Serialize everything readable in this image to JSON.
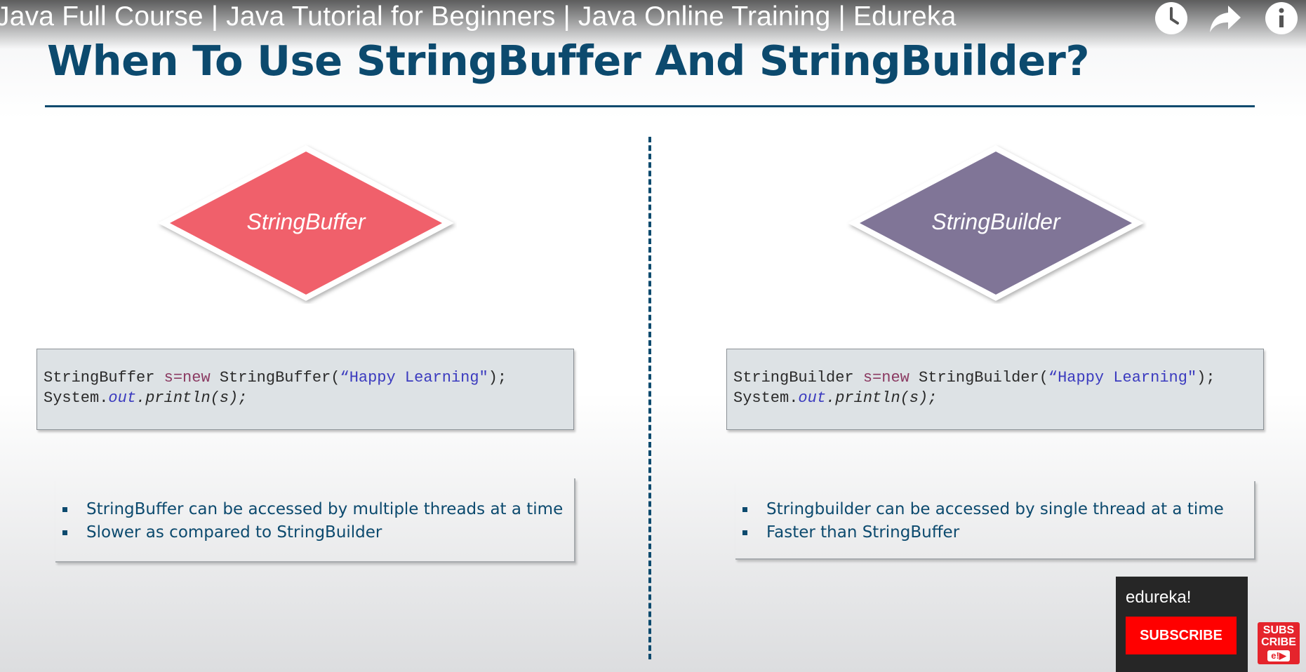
{
  "video": {
    "title": "Java Full Course | Java Tutorial for Beginners | Java Online Training | Edureka"
  },
  "controls": [
    {
      "name": "watch-later-icon"
    },
    {
      "name": "share-icon"
    },
    {
      "name": "info-icon"
    }
  ],
  "slide": {
    "title": "When To Use StringBuffer And StringBuilder?",
    "left": {
      "label": "StringBuffer",
      "color": "#f0606b",
      "code": {
        "l1_type": "StringBuffer ",
        "l1_var": "s=",
        "l1_new": "new",
        "l1_ctor": " StringBuffer(",
        "l1_str": "“Happy Learning\"",
        "l1_end": ");",
        "l2_sys": "System.",
        "l2_out": "out",
        "l2_rest": ".println(s);"
      },
      "bullets": [
        "StringBuffer can be accessed by multiple threads at a time",
        "Slower as compared to StringBuilder"
      ]
    },
    "right": {
      "label": "StringBuilder",
      "color": "#807597",
      "code": {
        "l1_type": "StringBuilder ",
        "l1_var": "s=",
        "l1_new": "new",
        "l1_ctor": " StringBuilder(",
        "l1_str": "“Happy Learning\"",
        "l1_end": ");",
        "l2_sys": "System.",
        "l2_out": "out",
        "l2_rest": ".println(s);"
      },
      "bullets": [
        "Stringbuilder can be accessed by single thread at a time",
        "Faster than StringBuffer"
      ]
    }
  },
  "subscribe_card": {
    "channel": "edureka!",
    "button": "SUBSCRIBE",
    "badge_line1": "SUBS",
    "badge_line2": "CRIBE",
    "badge_logo": "e!▶"
  }
}
